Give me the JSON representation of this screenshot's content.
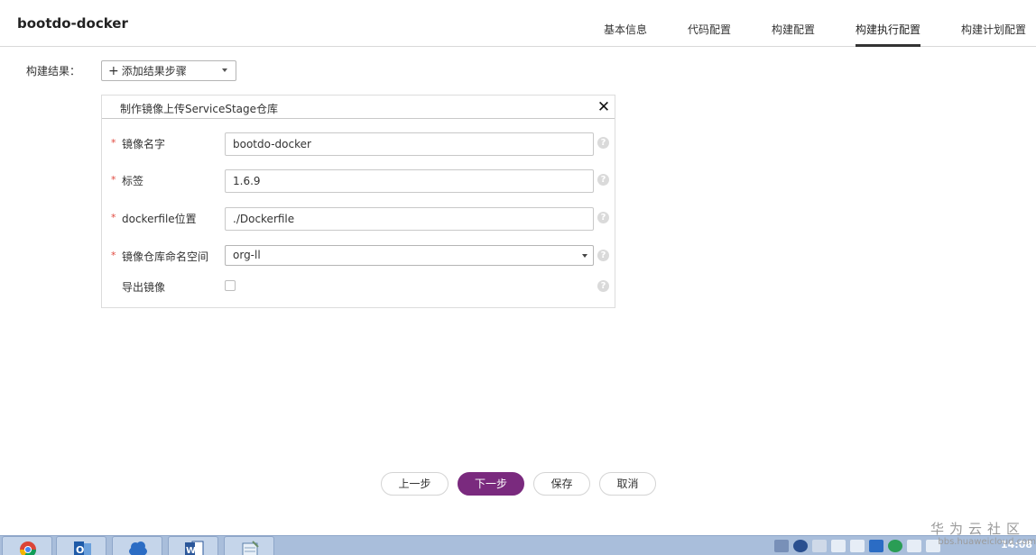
{
  "app": {
    "title": "bootdo-docker"
  },
  "tabs": [
    {
      "label": "基本信息",
      "active": false
    },
    {
      "label": "代码配置",
      "active": false
    },
    {
      "label": "构建配置",
      "active": false
    },
    {
      "label": "构建执行配置",
      "active": true
    },
    {
      "label": "构建计划配置",
      "active": false
    }
  ],
  "build_result": {
    "label": "构建结果：",
    "add_step": {
      "icon": "plus-icon",
      "label": "添加结果步骤"
    }
  },
  "panel": {
    "title": "制作镜像上传ServiceStage仓库",
    "close_icon": "close-icon",
    "fields": {
      "image_name": {
        "required_mark": "*",
        "label": "镜像名字",
        "value": "bootdo-docker"
      },
      "tag": {
        "required_mark": "*",
        "label": "标签",
        "value": "1.6.9"
      },
      "dockerfile": {
        "required_mark": "*",
        "label": "dockerfile位置",
        "value": "./Dockerfile"
      },
      "namespace": {
        "required_mark": "*",
        "label": "镜像仓库命名空间",
        "selected": "org-ll"
      },
      "export_image": {
        "label": "导出镜像",
        "checked": false
      }
    },
    "help_glyph": "?"
  },
  "footer": {
    "prev_label": "上一步",
    "next_label": "下一步",
    "save_label": "保存",
    "cancel_label": "取消"
  },
  "watermark": {
    "line1": "华为云社区",
    "line2": "bbs.huaweicloud.com"
  },
  "taskbar": {
    "apps": [
      "chrome-icon",
      "outlook-icon",
      "cloud-icon",
      "word-icon",
      "notepad-icon"
    ],
    "clock": "14:08"
  },
  "colors": {
    "primary": "#7a2a7e",
    "required": "#e0493f",
    "taskbar": "#a9bedb"
  }
}
